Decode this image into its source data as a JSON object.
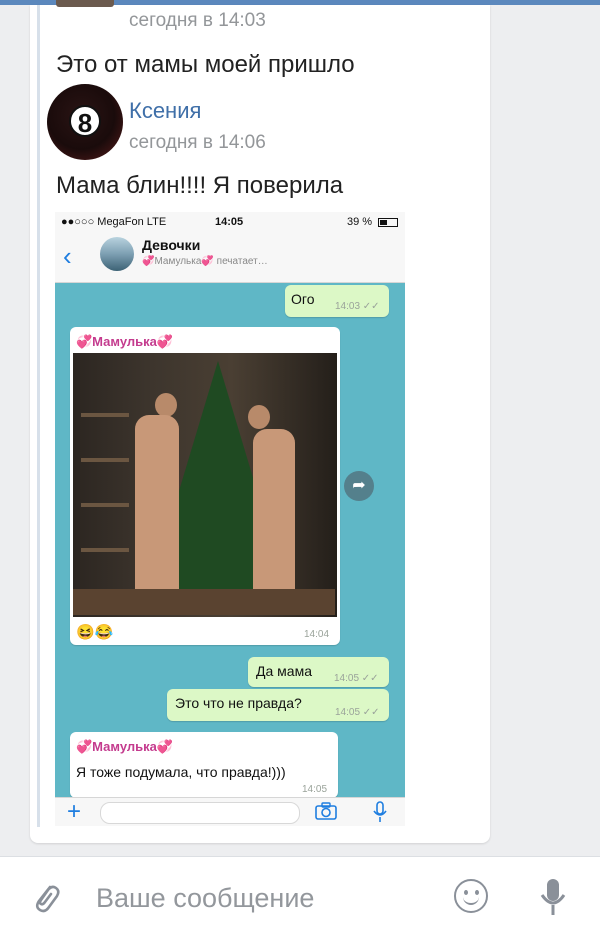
{
  "post": {
    "prev_time": "сегодня в 14:03",
    "prev_text": "Это от мамы моей пришло",
    "author": "Ксения",
    "avatar_glyph": "8",
    "time": "сегодня в 14:06",
    "text": "Мама блин!!!! Я поверила"
  },
  "screenshot": {
    "status": {
      "carrier": "●●○○○ MegaFon  LTE",
      "clock": "14:05",
      "battery": "39 %"
    },
    "header": {
      "back_glyph": "‹",
      "title": "Девочки",
      "typing": "💞Мамулька💞 печатает…"
    },
    "messages": [
      {
        "type": "out",
        "text": "Ого",
        "time": "14:03 ✓✓"
      },
      {
        "type": "in_photo",
        "sender": "💞Мамулька💞",
        "reactions": "😆😂",
        "time": "14:04"
      },
      {
        "type": "out",
        "text": "Да мама",
        "time": "14:05 ✓✓"
      },
      {
        "type": "out",
        "text": "Это что не правда?",
        "time": "14:05 ✓✓"
      },
      {
        "type": "in",
        "sender": "💞Мамулька💞",
        "text": "Я тоже подумала, что правда!)))",
        "time": "14:05"
      }
    ],
    "input": {
      "plus": "+",
      "camera_icon": "camera-icon",
      "mic_icon": "mic-icon"
    }
  },
  "composer": {
    "placeholder": "Ваше сообщение",
    "attach_icon": "paperclip-icon",
    "emoji_icon": "smile-icon",
    "mic_icon": "mic-icon"
  },
  "colors": {
    "accent": "#3f6fa8",
    "topbar": "#5b88bd",
    "wa_bg": "#5fb7c6",
    "bubble_out": "#dcf8c6"
  }
}
